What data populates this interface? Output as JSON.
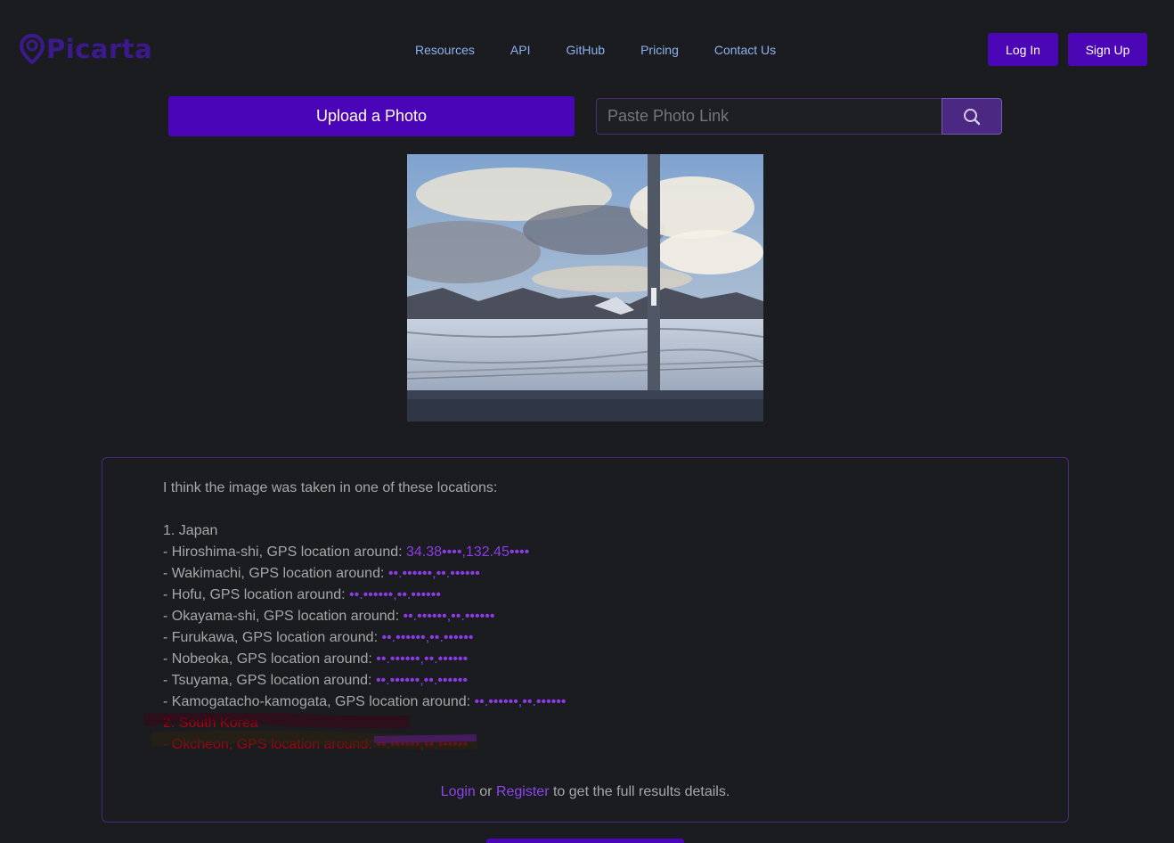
{
  "brand": {
    "name": "Picarta"
  },
  "nav": {
    "items": [
      {
        "label": "Resources"
      },
      {
        "label": "API"
      },
      {
        "label": "GitHub"
      },
      {
        "label": "Pricing"
      },
      {
        "label": "Contact Us"
      }
    ]
  },
  "auth": {
    "login_label": "Log In",
    "signup_label": "Sign Up"
  },
  "upload": {
    "button_label": "Upload a Photo",
    "link_placeholder": "Paste Photo Link"
  },
  "results": {
    "intro": "I think the image was taken in one of these locations:",
    "country1": "1. Japan",
    "prefix": "- ",
    "gps_text": ", GPS location around: ",
    "locations": [
      {
        "name": "Hiroshima-shi",
        "coords": "34.38••••,132.45••••"
      },
      {
        "name": "Wakimachi",
        "coords": "••.••••••,••.••••••"
      },
      {
        "name": "Hofu",
        "coords": "••.••••••,••.••••••"
      },
      {
        "name": "Okayama-shi",
        "coords": "••.••••••,••.••••••"
      },
      {
        "name": "Furukawa",
        "coords": "••.••••••,••.••••••"
      },
      {
        "name": "Nobeoka",
        "coords": "••.••••••,••.••••••"
      },
      {
        "name": "Tsuyama",
        "coords": "••.••••••,••.••••••"
      },
      {
        "name": "Kamogatacho-kamogata",
        "coords": "••.••••••,••.••••••"
      }
    ],
    "country2": "2. South Korea",
    "country2_line": "- Okcheon, GPS location around: ••.••••••,••.••••••",
    "cta_login": "Login",
    "cta_or": " or ",
    "cta_register": "Register",
    "cta_rest": " to get the full results details."
  },
  "colors": {
    "accent": "#4a05b8",
    "link": "#8fb1f0",
    "coord": "#8d3bea",
    "highlight": "#b00010"
  }
}
